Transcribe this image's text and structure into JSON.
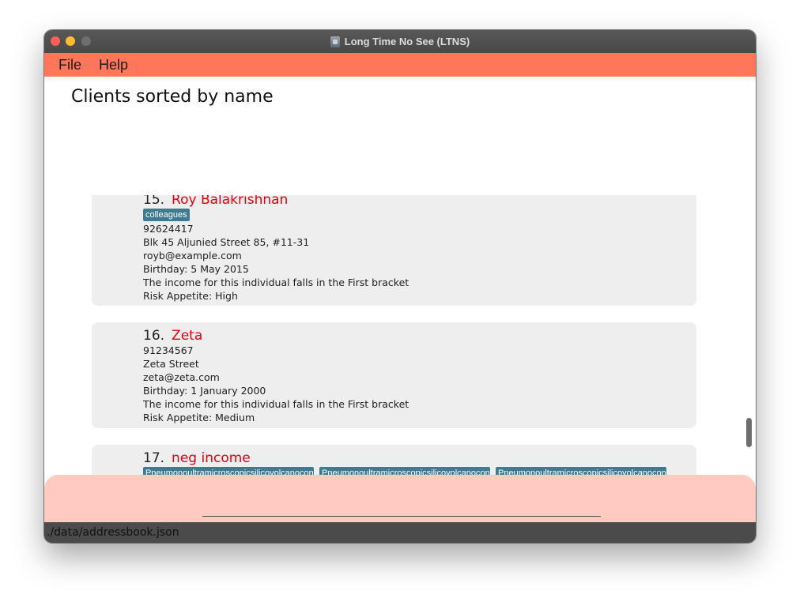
{
  "window": {
    "title": "Long Time No See (LTNS)"
  },
  "menu": {
    "file": "File",
    "help": "Help"
  },
  "main": {
    "heading": "Clients sorted by name"
  },
  "clients": [
    {
      "index": "15.",
      "name": "Roy Balakrishnan",
      "tags": [
        "colleagues"
      ],
      "phone": "92624417",
      "address": "Blk 45 Aljunied Street 85, #11-31",
      "email": "royb@example.com",
      "birthday": "Birthday: 5 May 2015",
      "income": "The income for this individual falls in the First bracket",
      "risk": "Risk Appetite: High"
    },
    {
      "index": "16.",
      "name": "Zeta",
      "phone": "91234567",
      "address": "Zeta Street",
      "email": "zeta@zeta.com",
      "birthday": "Birthday: 1 January 2000",
      "income": "The income for this individual falls in the First bracket",
      "risk": "Risk Appetite: Medium"
    },
    {
      "index": "17.",
      "name": "neg income",
      "tags": [
        "Pneumonoultramicroscopicsilicovolcanoconi",
        "Pneumonoultramicroscopicsilicovolcanoconio",
        "Pneumonoultramicroscopicsilicovolcanoconios"
      ]
    }
  ],
  "command": {
    "value": ""
  },
  "status": {
    "path": "./data/addressbook.json"
  },
  "colors": {
    "menubar": "#ff765a",
    "client_name": "#e3000f",
    "tag": "#3e7b91",
    "command_area": "#ffcbc0"
  }
}
